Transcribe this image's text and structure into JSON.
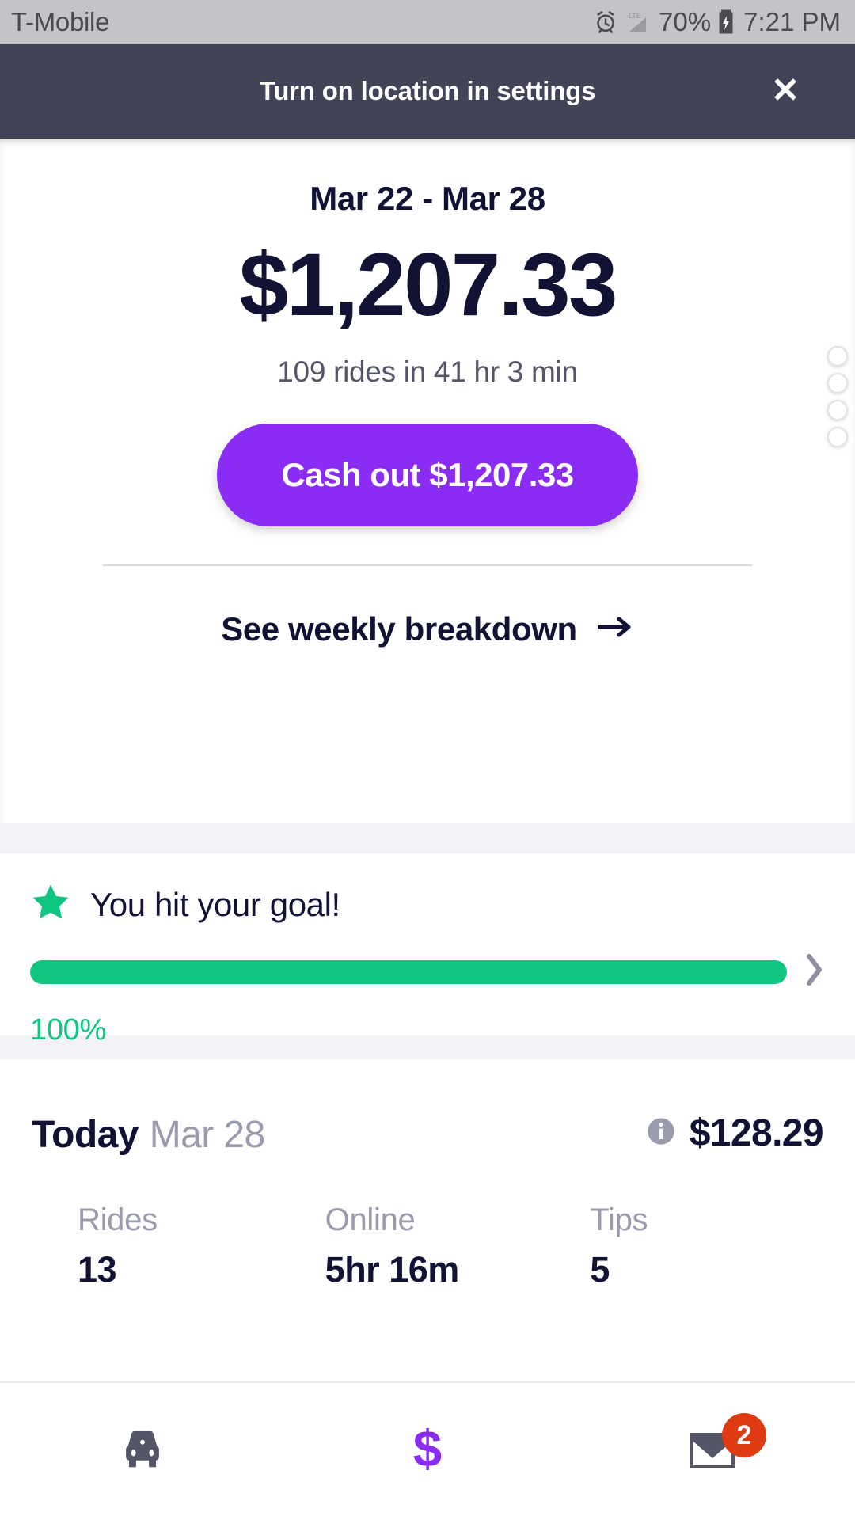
{
  "status_bar": {
    "carrier": "T-Mobile",
    "alarm_icon": "alarm-clock-icon",
    "network": "LTE",
    "signal_icon": "signal-bars-icon",
    "battery_percent": "70%",
    "battery_icon": "battery-charging-icon",
    "time": "7:21 PM"
  },
  "banner": {
    "message": "Turn on location in settings",
    "close_label": "✕",
    "background_color": "#434358"
  },
  "hero": {
    "date_range": "Mar 22 - Mar 28",
    "amount": "$1,207.33",
    "rides_summary": "109 rides in 41 hr 3 min",
    "cash_out_label": "Cash out $1,207.33",
    "cash_out_color": "#8b2cf5",
    "breakdown_label": "See weekly breakdown",
    "breakdown_arrow": "→",
    "page_dots_count": 4
  },
  "goal": {
    "star_icon": "star-icon",
    "headline": "You hit your goal!",
    "percent_label": "100%",
    "percent_value": 100,
    "accent_color": "#0ec67f",
    "chevron": "›"
  },
  "today": {
    "label": "Today",
    "date": "Mar 28",
    "info_icon": "info-icon",
    "total": "$128.29",
    "stats": [
      {
        "label": "Rides",
        "value": "13"
      },
      {
        "label": "Online",
        "value": "5hr 16m"
      },
      {
        "label": "Tips",
        "value": "5"
      }
    ]
  },
  "bottom_nav": {
    "items": [
      {
        "name": "rides-tab",
        "icon": "car-icon",
        "active": false
      },
      {
        "name": "earnings-tab",
        "icon": "dollar-sign-icon",
        "active": true
      },
      {
        "name": "inbox-tab",
        "icon": "envelope-icon",
        "active": false,
        "badge": "2"
      }
    ],
    "badge_color": "#e03a12",
    "active_color": "#8b2cf5",
    "inactive_color": "#555568"
  }
}
